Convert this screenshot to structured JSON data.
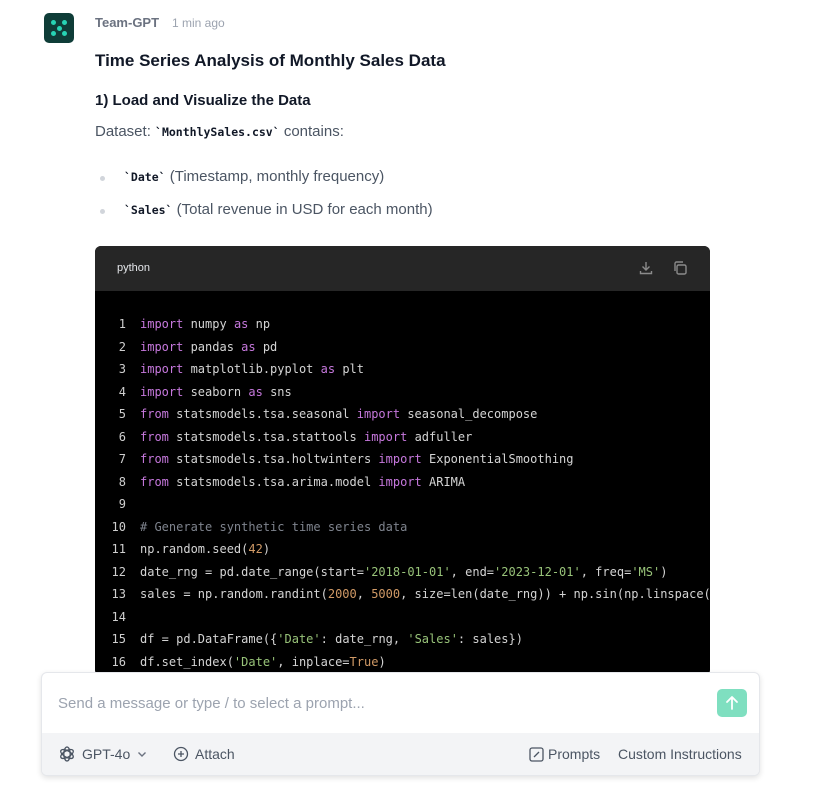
{
  "message": {
    "sender": "Team-GPT",
    "time": "1 min ago",
    "title": "Time Series Analysis of Monthly Sales Data",
    "section": "1) Load and Visualize the Data",
    "dataset_prefix": "Dataset: ",
    "dataset_file": "`MonthlySales.csv`",
    "dataset_suffix": " contains:",
    "bullets": [
      {
        "code": "`Date`",
        "text": " (Timestamp, monthly frequency)"
      },
      {
        "code": "`Sales`",
        "text": " (Total revenue in USD for each month)"
      }
    ]
  },
  "code_block": {
    "language": "python",
    "lines": [
      {
        "n": "1",
        "html": "<span class=\"kw\">import</span> numpy <span class=\"kw\">as</span> np"
      },
      {
        "n": "2",
        "html": "<span class=\"kw\">import</span> pandas <span class=\"kw\">as</span> pd"
      },
      {
        "n": "3",
        "html": "<span class=\"kw\">import</span> matplotlib.pyplot <span class=\"kw\">as</span> plt"
      },
      {
        "n": "4",
        "html": "<span class=\"kw\">import</span> seaborn <span class=\"kw\">as</span> sns"
      },
      {
        "n": "5",
        "html": "<span class=\"kw\">from</span> statsmodels.tsa.seasonal <span class=\"kw\">import</span> seasonal_decompose"
      },
      {
        "n": "6",
        "html": "<span class=\"kw\">from</span> statsmodels.tsa.stattools <span class=\"kw\">import</span> adfuller"
      },
      {
        "n": "7",
        "html": "<span class=\"kw\">from</span> statsmodels.tsa.holtwinters <span class=\"kw\">import</span> ExponentialSmoothing"
      },
      {
        "n": "8",
        "html": "<span class=\"kw\">from</span> statsmodels.tsa.arima.model <span class=\"kw\">import</span> ARIMA"
      },
      {
        "n": "9",
        "html": ""
      },
      {
        "n": "10",
        "html": "<span class=\"com\"># Generate synthetic time series data</span>"
      },
      {
        "n": "11",
        "html": "np.random.seed(<span class=\"num\">42</span>)"
      },
      {
        "n": "12",
        "html": "date_rng = pd.date_range(start=<span class=\"str\">'2018-01-01'</span>, end=<span class=\"str\">'2023-12-01'</span>, freq=<span class=\"str\">'MS'</span>)"
      },
      {
        "n": "13",
        "html": "sales = np.random.randint(<span class=\"num\">2000</span>, <span class=\"num\">5000</span>, size=len(date_rng)) + np.sin(np.linspace("
      },
      {
        "n": "14",
        "html": ""
      },
      {
        "n": "15",
        "html": "df = pd.DataFrame({<span class=\"str\">'Date'</span>: date_rng, <span class=\"str\">'Sales'</span>: sales})"
      },
      {
        "n": "16",
        "html": "df.set_index(<span class=\"str\">'Date'</span>, inplace=<span class=\"num\">True</span>)"
      }
    ]
  },
  "composer": {
    "placeholder": "Send a message or type / to select a prompt...",
    "model": "GPT-4o",
    "attach": "Attach",
    "prompts": "Prompts",
    "custom_instructions": "Custom Instructions"
  },
  "colors": {
    "accent": "#7fdfc0",
    "avatar_bg": "#0f3d38",
    "code_bg": "#000000",
    "keyword": "#c678dd",
    "string": "#98c379",
    "number": "#d19a66"
  }
}
